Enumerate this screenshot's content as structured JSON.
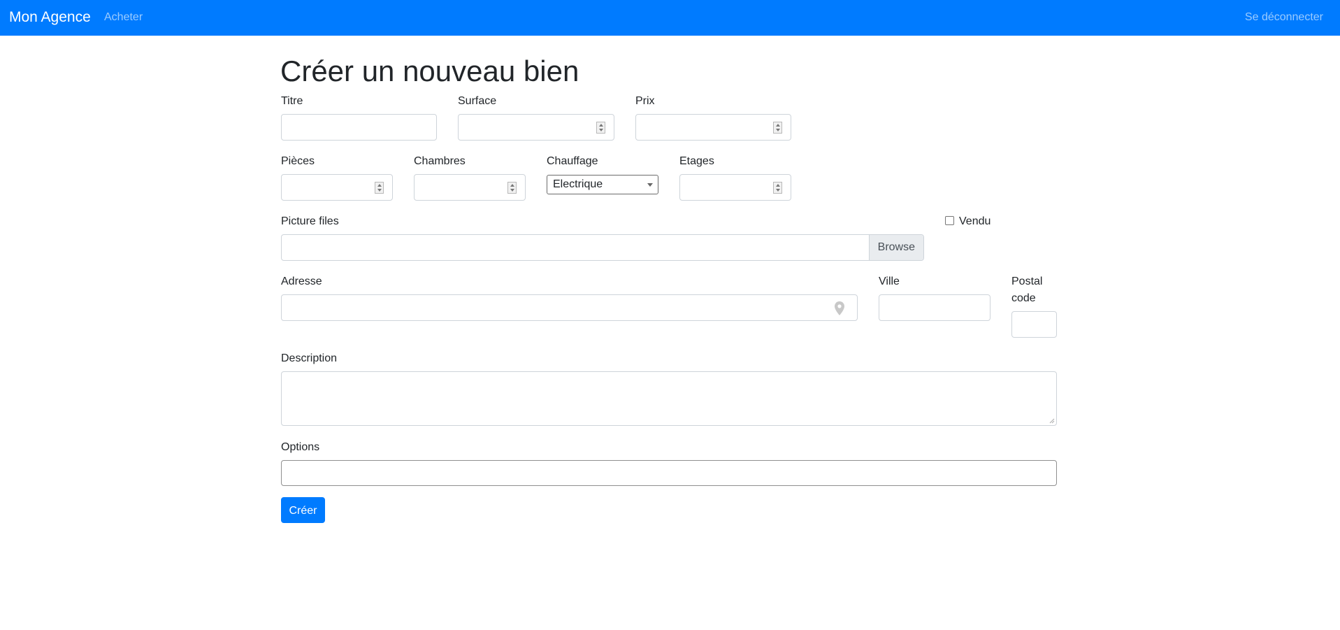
{
  "navbar": {
    "brand": "Mon Agence",
    "links": {
      "buy": "Acheter",
      "logout": "Se déconnecter"
    },
    "background": "#007bff"
  },
  "page": {
    "title": "Créer un nouveau bien"
  },
  "form": {
    "titre": {
      "label": "Titre",
      "value": ""
    },
    "surface": {
      "label": "Surface",
      "value": ""
    },
    "prix": {
      "label": "Prix",
      "value": ""
    },
    "pieces": {
      "label": "Pièces",
      "value": ""
    },
    "chambres": {
      "label": "Chambres",
      "value": ""
    },
    "chauffage": {
      "label": "Chauffage",
      "selected": "Electrique"
    },
    "etages": {
      "label": "Etages",
      "value": ""
    },
    "picture_files": {
      "label": "Picture files",
      "button": "Browse"
    },
    "vendu": {
      "label": "Vendu",
      "checked": false
    },
    "adresse": {
      "label": "Adresse",
      "value": "",
      "icon": "map-pin-icon"
    },
    "ville": {
      "label": "Ville",
      "value": ""
    },
    "postal_code": {
      "label_line1": "Postal",
      "label_line2": "code",
      "value": ""
    },
    "description": {
      "label": "Description",
      "value": ""
    },
    "options": {
      "label": "Options",
      "value": ""
    },
    "submit": {
      "label": "Créer"
    }
  }
}
